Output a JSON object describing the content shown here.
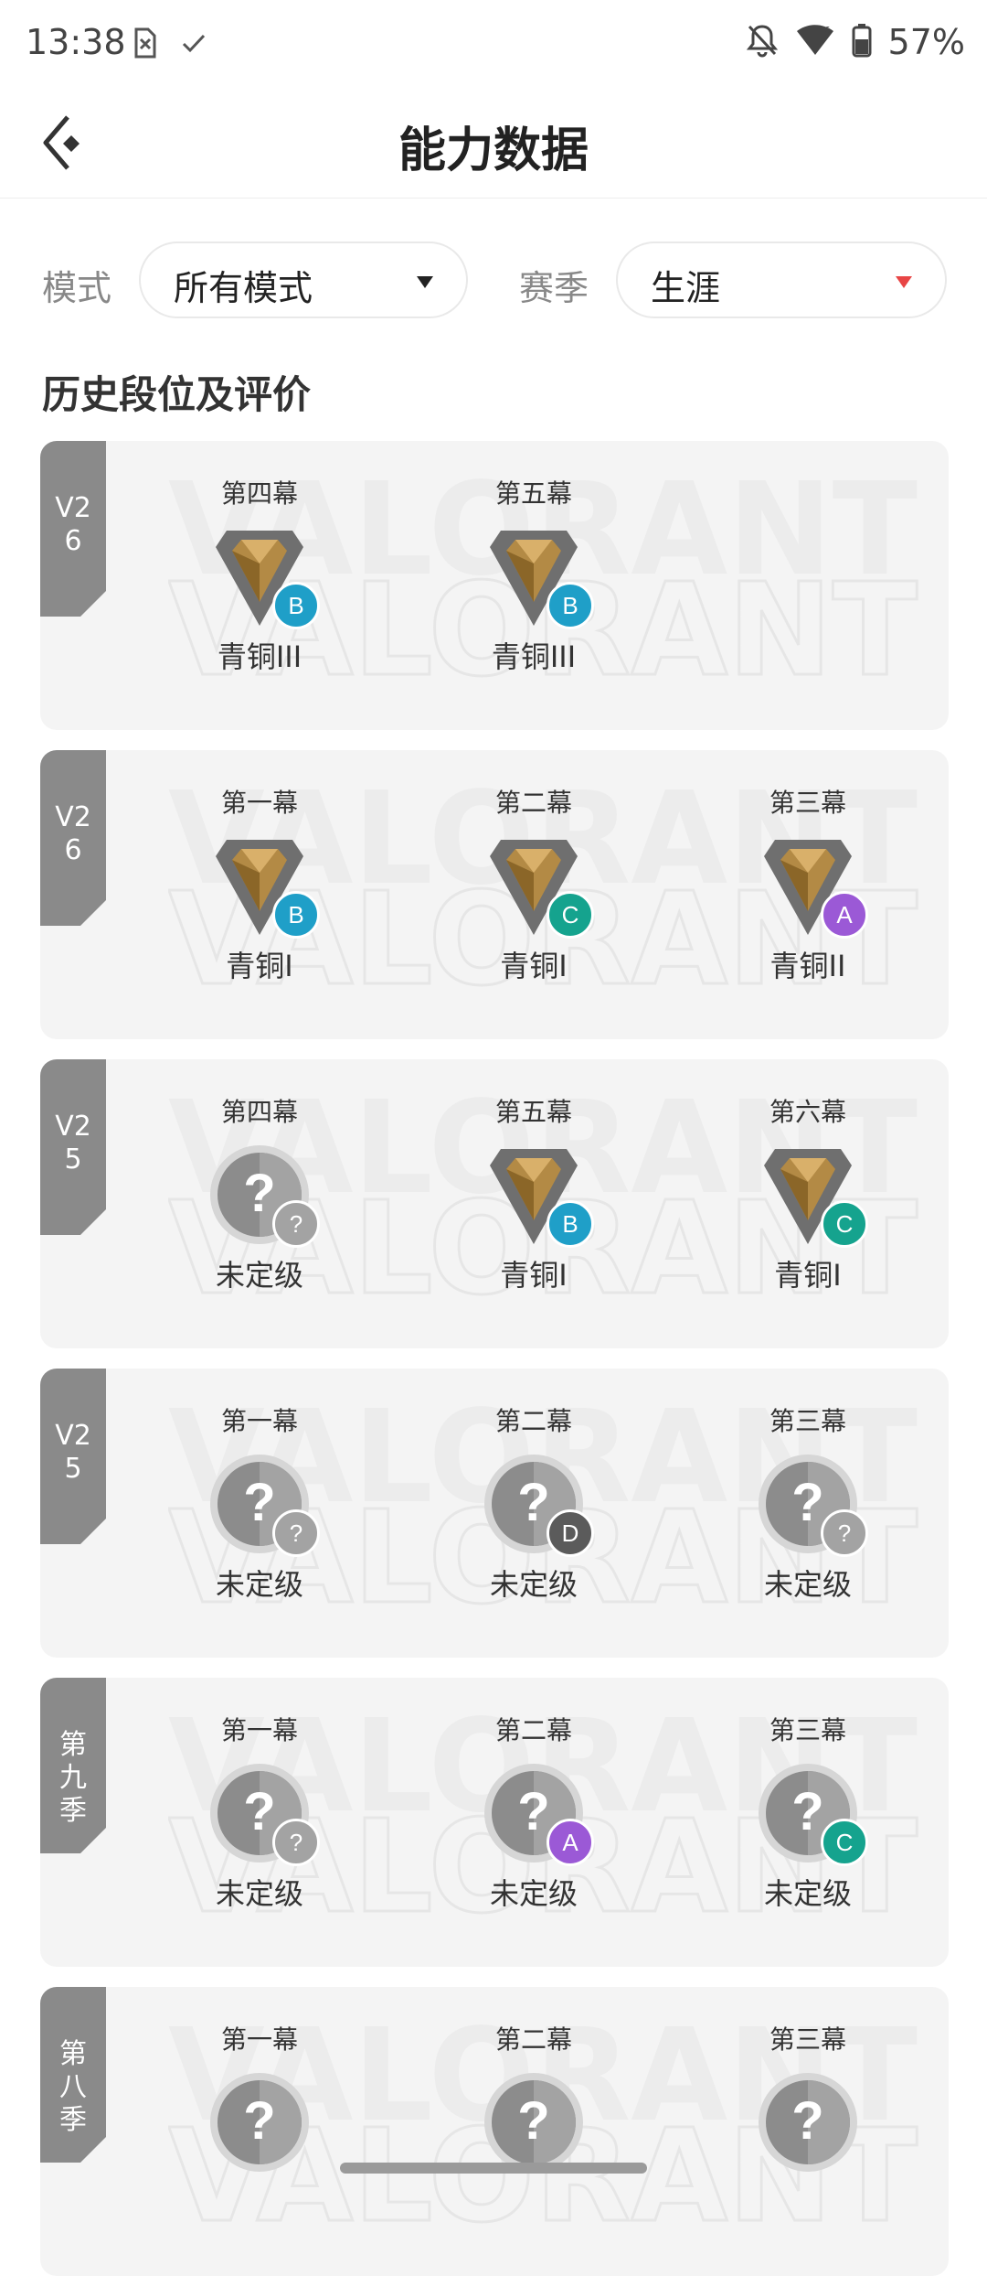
{
  "status_bar": {
    "time": "13:38",
    "battery": "57%"
  },
  "header": {
    "title": "能力数据"
  },
  "filters": {
    "mode_label": "模式",
    "mode_value": "所有模式",
    "season_label": "赛季",
    "season_value": "生涯"
  },
  "section_title": "历史段位及评价",
  "watermark_text": "VALORANT",
  "grade_colors": {
    "A": "#9b59d6",
    "B": "#1f9fc8",
    "C": "#15a38e",
    "D": "#5b5b5b",
    "?": "#a3a3a3"
  },
  "seasons": [
    {
      "tag": "V2\n6",
      "acts": [
        {
          "name": "第四幕",
          "rank": "青铜III",
          "emblem": "bronze",
          "grade": "B"
        },
        {
          "name": "第五幕",
          "rank": "青铜III",
          "emblem": "bronze",
          "grade": "B"
        }
      ]
    },
    {
      "tag": "V2\n6",
      "acts": [
        {
          "name": "第一幕",
          "rank": "青铜I",
          "emblem": "bronze",
          "grade": "B"
        },
        {
          "name": "第二幕",
          "rank": "青铜I",
          "emblem": "bronze",
          "grade": "C"
        },
        {
          "name": "第三幕",
          "rank": "青铜II",
          "emblem": "bronze",
          "grade": "A"
        }
      ]
    },
    {
      "tag": "V2\n5",
      "acts": [
        {
          "name": "第四幕",
          "rank": "未定级",
          "emblem": "unranked",
          "grade": "?"
        },
        {
          "name": "第五幕",
          "rank": "青铜I",
          "emblem": "bronze",
          "grade": "B"
        },
        {
          "name": "第六幕",
          "rank": "青铜I",
          "emblem": "bronze",
          "grade": "C"
        }
      ]
    },
    {
      "tag": "V2\n5",
      "acts": [
        {
          "name": "第一幕",
          "rank": "未定级",
          "emblem": "unranked",
          "grade": "?"
        },
        {
          "name": "第二幕",
          "rank": "未定级",
          "emblem": "unranked",
          "grade": "D"
        },
        {
          "name": "第三幕",
          "rank": "未定级",
          "emblem": "unranked",
          "grade": "?"
        }
      ]
    },
    {
      "tag": "第\n九\n季",
      "acts": [
        {
          "name": "第一幕",
          "rank": "未定级",
          "emblem": "unranked",
          "grade": "?"
        },
        {
          "name": "第二幕",
          "rank": "未定级",
          "emblem": "unranked",
          "grade": "A"
        },
        {
          "name": "第三幕",
          "rank": "未定级",
          "emblem": "unranked",
          "grade": "C"
        }
      ]
    },
    {
      "tag": "第\n八\n季",
      "acts": [
        {
          "name": "第一幕",
          "rank": "",
          "emblem": "unranked",
          "grade": ""
        },
        {
          "name": "第二幕",
          "rank": "",
          "emblem": "unranked",
          "grade": ""
        },
        {
          "name": "第三幕",
          "rank": "",
          "emblem": "unranked",
          "grade": ""
        }
      ]
    }
  ]
}
